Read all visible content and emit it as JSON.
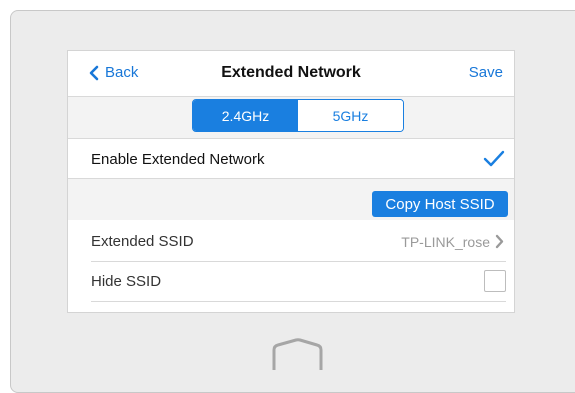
{
  "nav": {
    "back_label": "Back",
    "title": "Extended Network",
    "save_label": "Save"
  },
  "bands": {
    "items": [
      "2.4GHz",
      "5GHz"
    ],
    "selected": "2.4GHz"
  },
  "enable": {
    "label": "Enable Extended Network",
    "checked": true
  },
  "copy_button": "Copy Host SSID",
  "settings": {
    "extended_ssid_label": "Extended SSID",
    "extended_ssid_value": "TP-LINK_rose",
    "hide_ssid_label": "Hide SSID",
    "hide_ssid_checked": false
  },
  "icons": {
    "back": "chevron-left-icon",
    "check": "checkmark-icon",
    "row_arrow": "chevron-right-icon",
    "home": "home-icon"
  },
  "colors": {
    "accent": "#1a7fe0",
    "link": "#1877d8",
    "secondary_text": "#9a9a9a"
  }
}
